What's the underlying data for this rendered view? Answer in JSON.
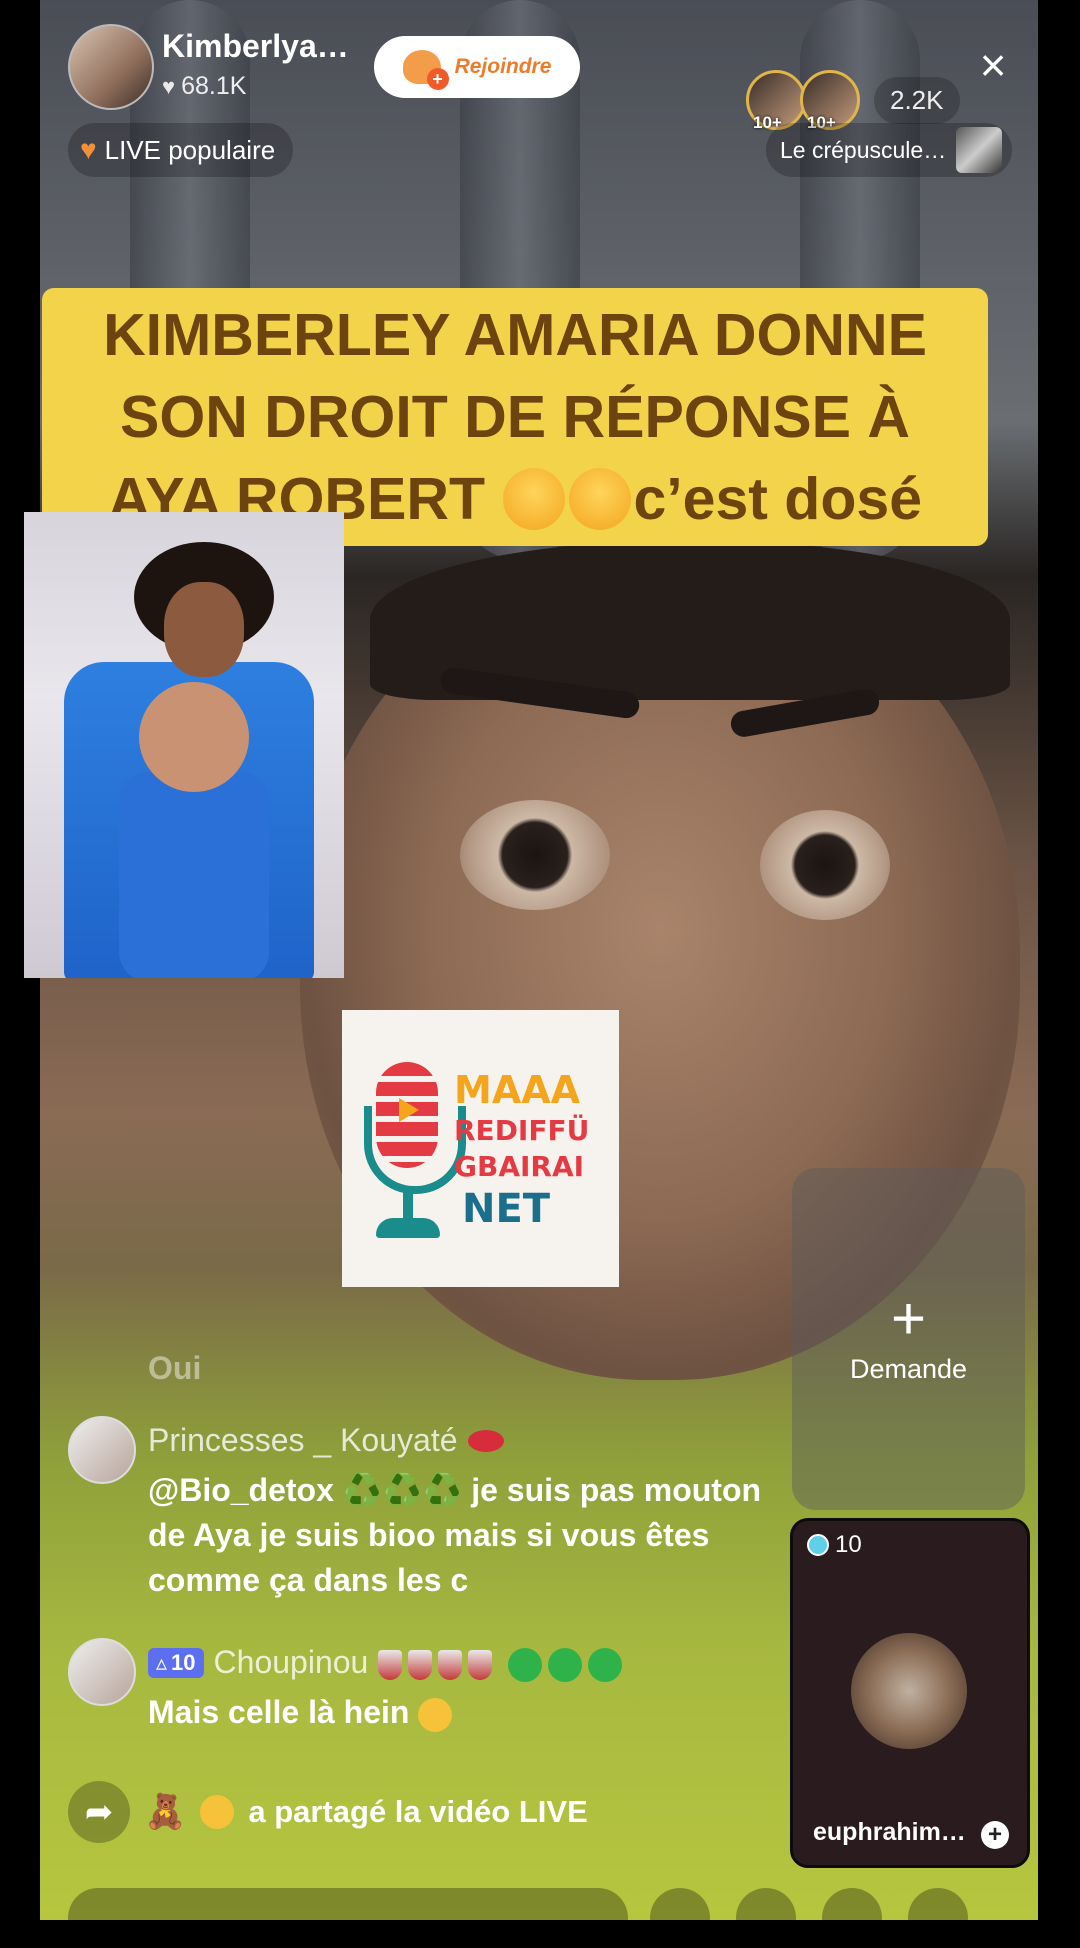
{
  "header": {
    "host_name": "Kimberlya…",
    "likes": "68.1K",
    "join_label": "Rejoindre",
    "viewer_badges": [
      "10+",
      "10+"
    ],
    "viewer_count": "2.2K",
    "close_icon": "×"
  },
  "pills": {
    "live_label": "LIVE populaire",
    "song_label": "Le crépuscule…"
  },
  "headline": {
    "line1": "KIMBERLEY AMARIA DONNE",
    "line2": "SON DROIT DE RÉPONSE À",
    "line3_a": "AYA ROBERT",
    "line3_b": "c’est dosé"
  },
  "logo": {
    "line1": "MAAA",
    "line2": "REDIFFÜ",
    "line3": "GBAIRAI",
    "line4": "NET"
  },
  "side": {
    "demande_label": "Demande",
    "gift_count": "10",
    "gift_user": "euphrahim…"
  },
  "chat": {
    "ghost_text": "Oui",
    "messages": [
      {
        "user": "Princesses _ Kouyaté",
        "text": "@Bio_detox ♻️♻️♻️ je suis pas mouton de Aya je suis bioo mais si vous êtes comme ça dans les c"
      },
      {
        "level": "10",
        "user": "Choupinou",
        "text": "Mais celle là hein"
      }
    ],
    "share_text": "a partagé la vidéo LIVE"
  },
  "colors": {
    "headline_bg": "#f2d34a",
    "headline_text": "#6d4410",
    "join_accent": "#ec7b2b",
    "level_badge": "#5b6ff0"
  },
  "icons": {
    "like": "heart-icon",
    "join": "heart-plus-icon",
    "close": "close-icon",
    "live": "heart-icon",
    "share": "share-arrow-icon",
    "demande": "plus-icon"
  }
}
